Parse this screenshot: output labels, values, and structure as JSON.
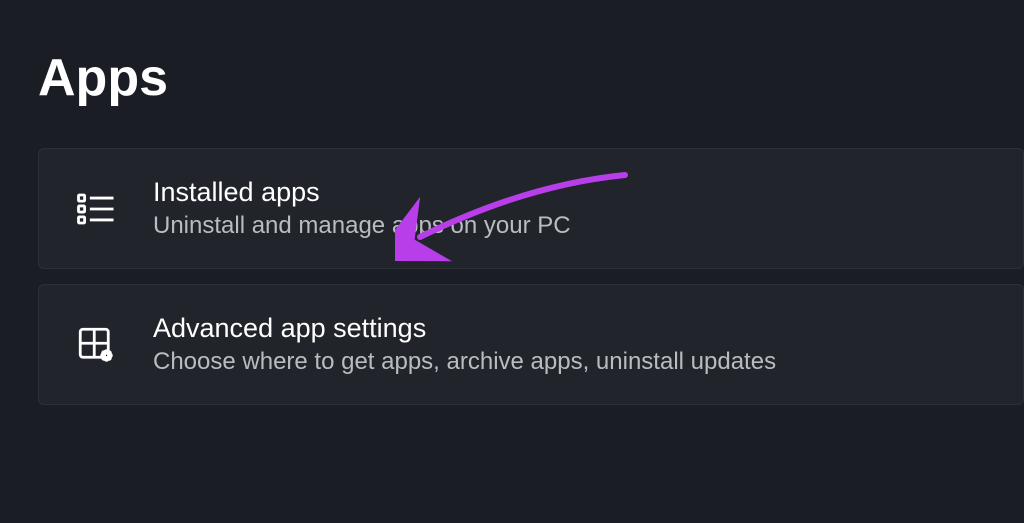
{
  "page": {
    "title": "Apps"
  },
  "items": [
    {
      "icon": "list-icon",
      "title": "Installed apps",
      "description": "Uninstall and manage apps on your PC"
    },
    {
      "icon": "grid-gear-icon",
      "title": "Advanced app settings",
      "description": "Choose where to get apps, archive apps, uninstall updates"
    }
  ],
  "annotation": {
    "arrow_color": "#b73ee8"
  }
}
